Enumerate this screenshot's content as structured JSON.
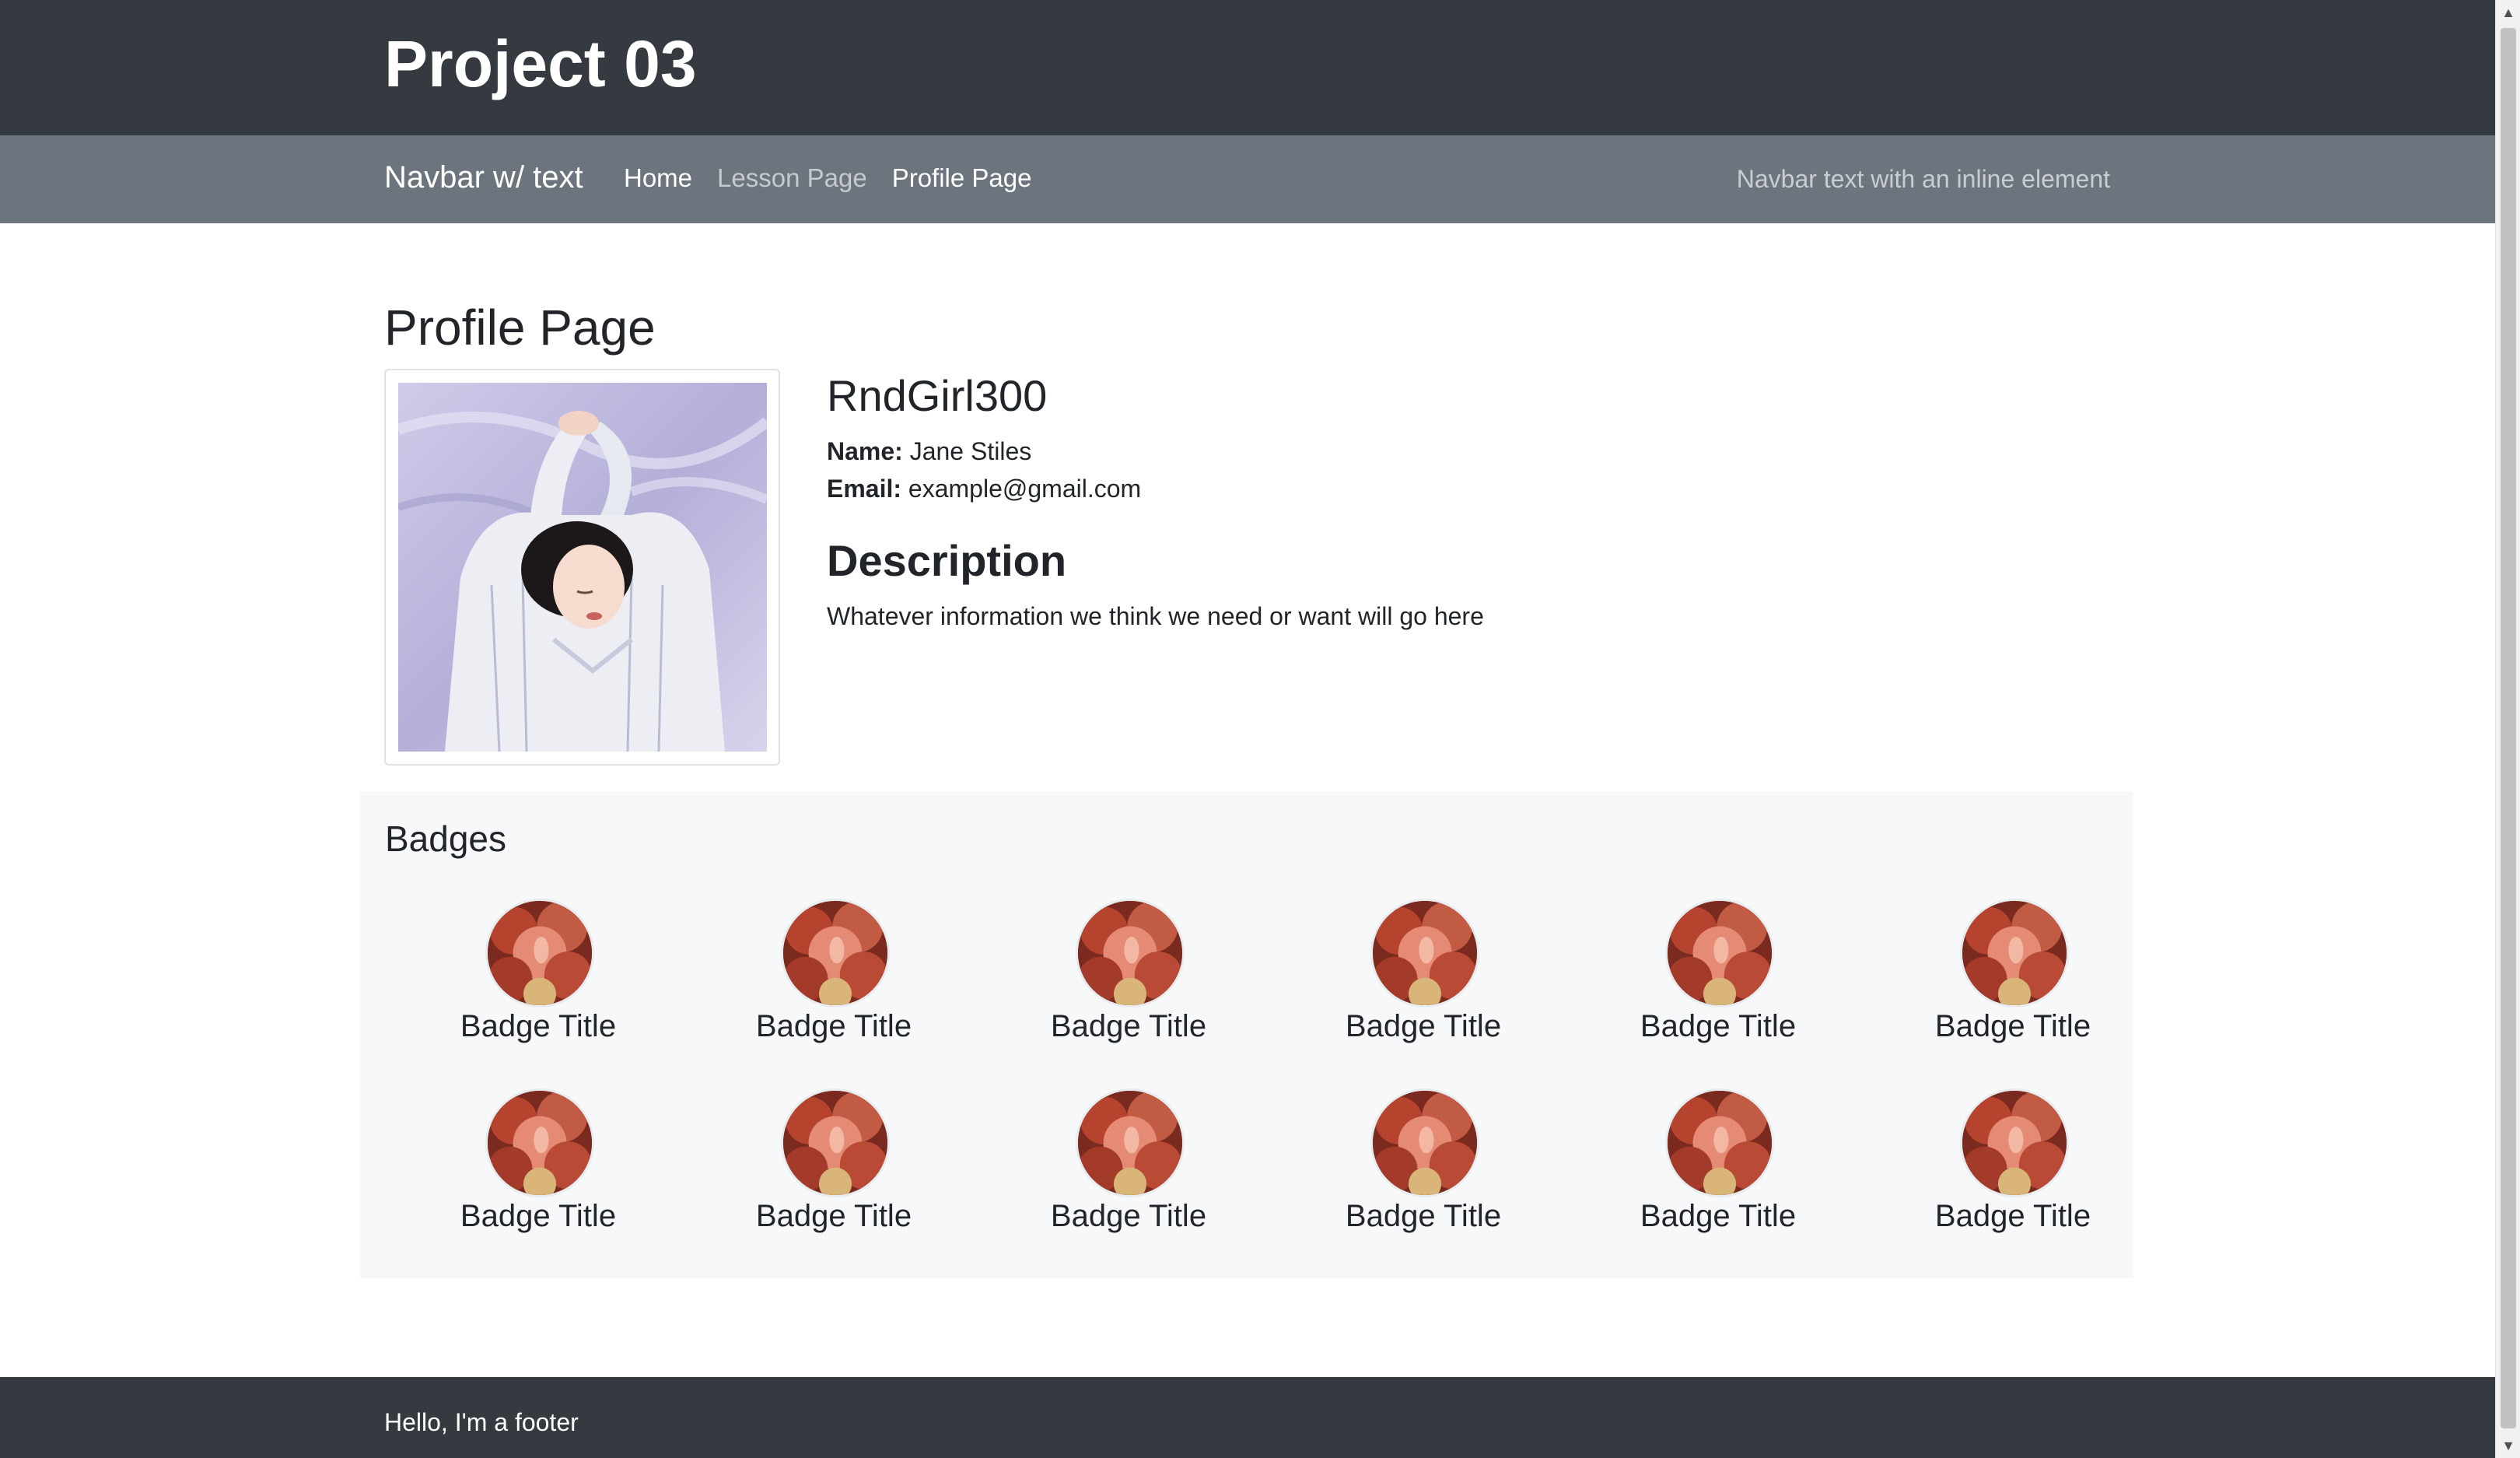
{
  "header": {
    "title": "Project 03"
  },
  "navbar": {
    "brand": "Navbar w/ text",
    "links": [
      {
        "label": "Home",
        "state": "active"
      },
      {
        "label": "Lesson Page",
        "state": "muted"
      },
      {
        "label": "Profile Page",
        "state": "active"
      }
    ],
    "text": "Navbar text with an inline element"
  },
  "profile": {
    "page_title": "Profile Page",
    "username": "RndGirl300",
    "name_label": "Name:",
    "name_value": "Jane Stiles",
    "email_label": "Email:",
    "email_value": "example@gmail.com",
    "description_title": "Description",
    "description_text": "Whatever information we think we need or want will go here"
  },
  "badges": {
    "title": "Badges",
    "items": [
      "Badge Title",
      "Badge Title",
      "Badge Title",
      "Badge Title",
      "Badge Title",
      "Badge Title",
      "Badge Title",
      "Badge Title",
      "Badge Title",
      "Badge Title",
      "Badge Title",
      "Badge Title"
    ]
  },
  "footer": {
    "text": "Hello, I'm a footer"
  },
  "colors": {
    "header_bg": "#343a40",
    "navbar_bg": "#6c757d",
    "badges_bg": "#f7f8f9",
    "footer_bg": "#343a40"
  }
}
